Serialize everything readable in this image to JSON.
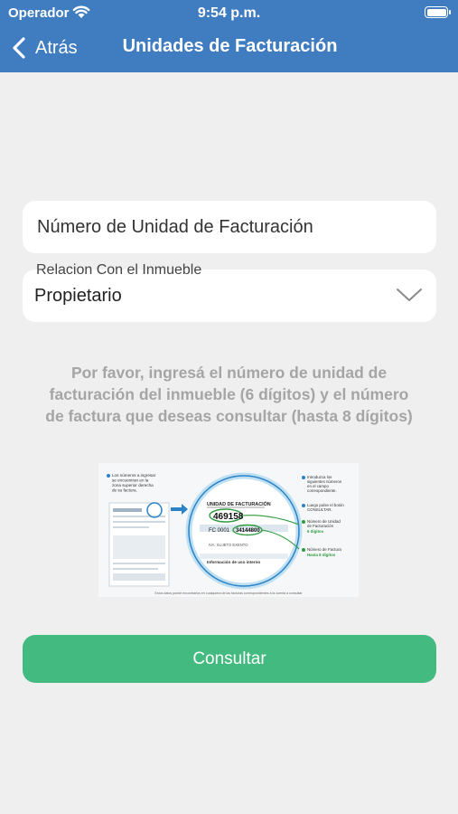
{
  "status": {
    "carrier": "Operador",
    "time": "9:54 p.m."
  },
  "nav": {
    "back_label": "Atrás",
    "title": "Unidades de Facturación"
  },
  "form": {
    "unidad_placeholder": "Número de Unidad de Facturación",
    "relacion_label": "Relacion Con el Inmueble",
    "relacion_value": "Propietario"
  },
  "hint": {
    "line1": "Por favor, ingresá el número de unidad de",
    "line2": "facturación del inmueble (6 dígitos) y el número",
    "line3": "de factura que deseas consultar (hasta 8 dígitos)"
  },
  "illustration": {
    "left_note": [
      "Los números a ingresar",
      "se encuentran en la",
      "zona superior derecha",
      "de su factura."
    ],
    "header": "UNIDAD DE FACTURACIÓN",
    "unit_number": "469158",
    "fc_prefix": "FC 0001",
    "invoice_number": "34144800",
    "row_text": "IVA: SUJETO EXENTO",
    "usage_text": "Información de uso interno",
    "note1": [
      "Introduzca los",
      "siguientes números",
      "en el campo",
      "correspondiente."
    ],
    "note2": [
      "Luego pulse el botón",
      "CONSULTAR."
    ],
    "note3_title": [
      "Número de Unidad",
      "de Facturación"
    ],
    "note3_digits": "6 dígitos",
    "note4_title": "Número de Factura",
    "note4_digits": "Hasta 8 dígitos",
    "footer": "Estos datos puede encontrarlos en cualquiera de las facturas correspondientes a la cuenta a consultar"
  },
  "action": {
    "button_label": "Consultar"
  },
  "colors": {
    "nav_bar": "#3f7cc0",
    "primary_button": "#43ba7f",
    "background": "#efeff0",
    "accent_green": "#2e9b3e"
  }
}
